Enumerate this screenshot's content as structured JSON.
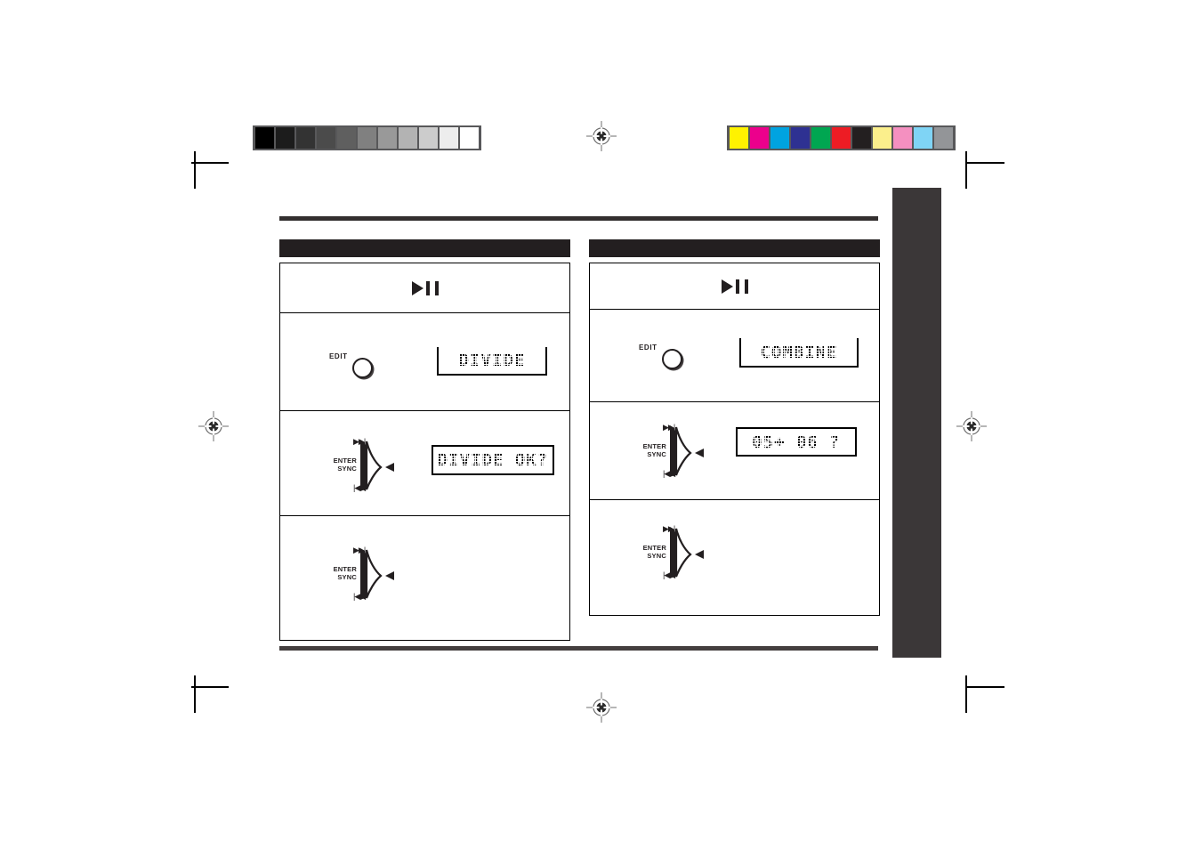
{
  "page": {
    "kind": "scanned-manual-page",
    "background": "#ffffff",
    "ink": "#231f20"
  },
  "calibration": {
    "gray_bar": {
      "name": "grayscale-step-wedge",
      "swatches": [
        "#000000",
        "#1c1c1c",
        "#333333",
        "#4b4b4b",
        "#5f5f5f",
        "#808080",
        "#999999",
        "#b3b3b3",
        "#cccccc",
        "#ededed",
        "#ffffff"
      ]
    },
    "color_bar": {
      "name": "process-color-control-strip",
      "swatches": [
        "#fff200",
        "#ec008c",
        "#00a3e0",
        "#2e3192",
        "#00a651",
        "#ed1c24",
        "#231f20",
        "#fbef8c",
        "#f490c0",
        "#7fd4f5",
        "#939598"
      ]
    },
    "frame_color": "#58585a"
  },
  "marks": {
    "registration_targets": 3,
    "crop_marks": 8
  },
  "rules": {
    "top_rule_color": "#332f2f",
    "bottom_rule_color": "#443f3f"
  },
  "side_tab": {
    "label": "",
    "color": "#3b3738"
  },
  "columns": [
    {
      "id": "divide",
      "header_label": "",
      "header_color": "#231f20",
      "steps": [
        {
          "id": "divide-step-transport",
          "control": "play-pause",
          "control_label": "",
          "display": null,
          "has_divider": true
        },
        {
          "id": "divide-step-edit",
          "control": "edit-knob",
          "control_label": "EDIT",
          "display": {
            "text": "DIVIDE",
            "style": "open-top"
          },
          "has_divider": true
        },
        {
          "id": "divide-step-enter-1",
          "control": "jog-enter-sync",
          "control_label": "ENTER\nSYNC",
          "skip_forward": "▶▶|",
          "skip_back": "|◀◀",
          "display": {
            "text": "DIVIDE OK?",
            "style": "boxed"
          },
          "has_divider": true
        },
        {
          "id": "divide-step-enter-2",
          "control": "jog-enter-sync",
          "control_label": "ENTER\nSYNC",
          "skip_forward": "▶▶|",
          "skip_back": "|◀◀",
          "display": null,
          "has_divider": false
        }
      ]
    },
    {
      "id": "combine",
      "header_label": "",
      "header_color": "#231f20",
      "steps": [
        {
          "id": "combine-step-transport",
          "control": "play-pause",
          "control_label": "",
          "display": null,
          "has_divider": true
        },
        {
          "id": "combine-step-edit",
          "control": "edit-knob",
          "control_label": "EDIT",
          "display": {
            "text": "COMBINE",
            "style": "open-top"
          },
          "has_divider": true
        },
        {
          "id": "combine-step-enter-1",
          "control": "jog-enter-sync",
          "control_label": "ENTER\nSYNC",
          "skip_forward": "▶▶|",
          "skip_back": "|◀◀",
          "display": {
            "text": "05+ 06 ?",
            "style": "boxed"
          },
          "has_divider": true
        },
        {
          "id": "combine-step-enter-2",
          "control": "jog-enter-sync",
          "control_label": "ENTER\nSYNC",
          "skip_forward": "▶▶|",
          "skip_back": "|◀◀",
          "display": null,
          "has_divider": false
        }
      ]
    }
  ],
  "labels": {
    "edit": "EDIT",
    "enter": "ENTER",
    "sync": "SYNC"
  },
  "displays": {
    "divide": "DIVIDE",
    "divide_ok": "DIVIDE OK?",
    "combine": "COMBINE",
    "track_combine": "05+ 06 ?"
  }
}
